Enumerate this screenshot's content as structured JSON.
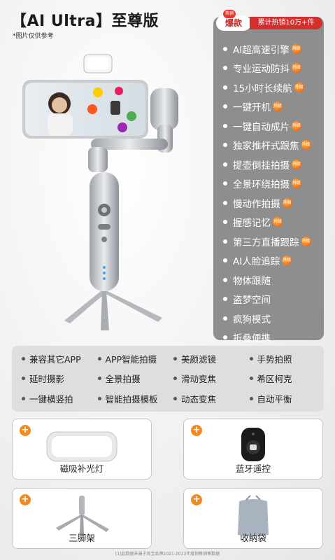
{
  "header": {
    "title": "【AI Ultra】至尊版",
    "subtitle": "*图片仅供参考"
  },
  "hot": {
    "badge": "爆款",
    "tag": "热销",
    "sales": "累计热销10万+件"
  },
  "features": [
    {
      "label": "AI超高速引擎",
      "upgrade": true
    },
    {
      "label": "专业运动防抖",
      "upgrade": true
    },
    {
      "label": "15小时长续航",
      "upgrade": true
    },
    {
      "label": "一键开机",
      "upgrade": true
    },
    {
      "label": "一键自动成片",
      "upgrade": true
    },
    {
      "label": "独家推杆式跟焦",
      "upgrade": true
    },
    {
      "label": "提壶倒挂拍摄",
      "upgrade": true
    },
    {
      "label": "全景环绕拍摄",
      "upgrade": true
    },
    {
      "label": "慢动作拍摄",
      "upgrade": true
    },
    {
      "label": "握感记忆",
      "upgrade": true
    },
    {
      "label": "第三方直播跟踪",
      "upgrade": true
    },
    {
      "label": "AI人脸追踪",
      "upgrade": true
    },
    {
      "label": "物体跟随",
      "upgrade": false
    },
    {
      "label": "盗梦空间",
      "upgrade": false
    },
    {
      "label": "疯狗模式",
      "upgrade": false
    },
    {
      "label": "折叠便携",
      "upgrade": false
    }
  ],
  "upgrade_label": "升级",
  "modes": [
    "兼容其它APP",
    "APP智能拍摄",
    "美颜滤镜",
    "手势拍照",
    "延时摄影",
    "全景拍摄",
    "滑动变焦",
    "希区柯克",
    "一键横竖拍",
    "智能拍摄模板",
    "动态变焦",
    "自动平衡"
  ],
  "accessories": [
    {
      "label": "磁吸补光灯",
      "icon": "fill-light-icon"
    },
    {
      "label": "蓝牙遥控",
      "icon": "bluetooth-remote-icon"
    },
    {
      "label": "三脚架",
      "icon": "tripod-icon"
    },
    {
      "label": "收纳袋",
      "icon": "storage-bag-icon"
    }
  ],
  "footnote": "[1]此数据来源于淘宝品牌2021-2023年度销售销售数据",
  "colors": {
    "panel": "#8e8e8e",
    "hot_red": "#d32f2f",
    "plus_orange": "#f08a24"
  }
}
